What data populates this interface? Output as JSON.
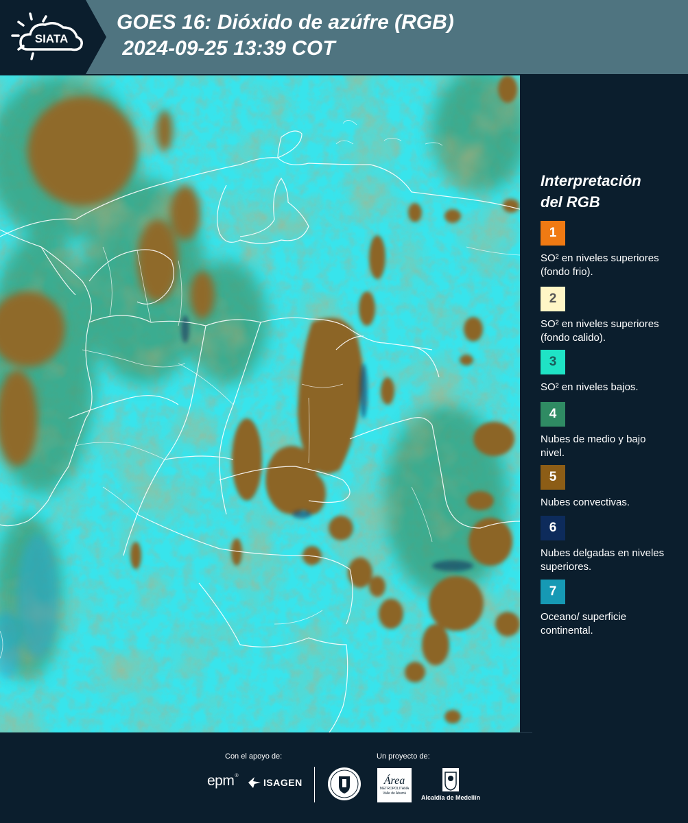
{
  "header": {
    "logo_text": "SIATA",
    "title_line1": "GOES 16: Dióxido de azúfre (RGB)",
    "title_line2": " 2024-09-25 13:39 COT"
  },
  "legend": {
    "title_line1": "Interpretación",
    "title_line2": "del RGB",
    "items": [
      {
        "num": "1",
        "text": "SO² en niveles superiores (fondo frio).",
        "color": "#f07a13",
        "num_color": "#ffffff"
      },
      {
        "num": "2",
        "text": "SO² en niveles superiores (fondo calido).",
        "color": "#fff6c6",
        "num_color": "#555555"
      },
      {
        "num": "3",
        "text": "SO² en niveles bajos.",
        "color": "#1fe3c5",
        "num_color": "#1a5b5a"
      },
      {
        "num": "4",
        "text": "Nubes de medio y bajo nivel.",
        "color": "#2f8b63",
        "num_color": "#ffffff"
      },
      {
        "num": "5",
        "text": "Nubes convectivas.",
        "color": "#8c5d16",
        "num_color": "#ffffff"
      },
      {
        "num": "6",
        "text": "Nubes delgadas en niveles superiores.",
        "color": "#0d2b5b",
        "num_color": "#ffffff"
      },
      {
        "num": "7",
        "text": "Oceano/ superficie continental.",
        "color": "#1699b4",
        "num_color": "#ffffff"
      }
    ]
  },
  "footer": {
    "support_label": "Con el apoyo de:",
    "project_label": "Un proyecto de:",
    "epm_text": "epm",
    "isagen_text": "ISAGEN",
    "area_text": "Área",
    "area_sub1": "METROPOLITANA",
    "area_sub2": "Valle de Aburrá",
    "medellin_text": "Alcaldía de Medellín"
  },
  "colors": {
    "header_bg": "#4f7480",
    "page_bg": "#0b1e2d",
    "map_clear": "#35e3ea",
    "map_convective": "#8c6a2a",
    "map_lowcloud": "#3a9270"
  }
}
